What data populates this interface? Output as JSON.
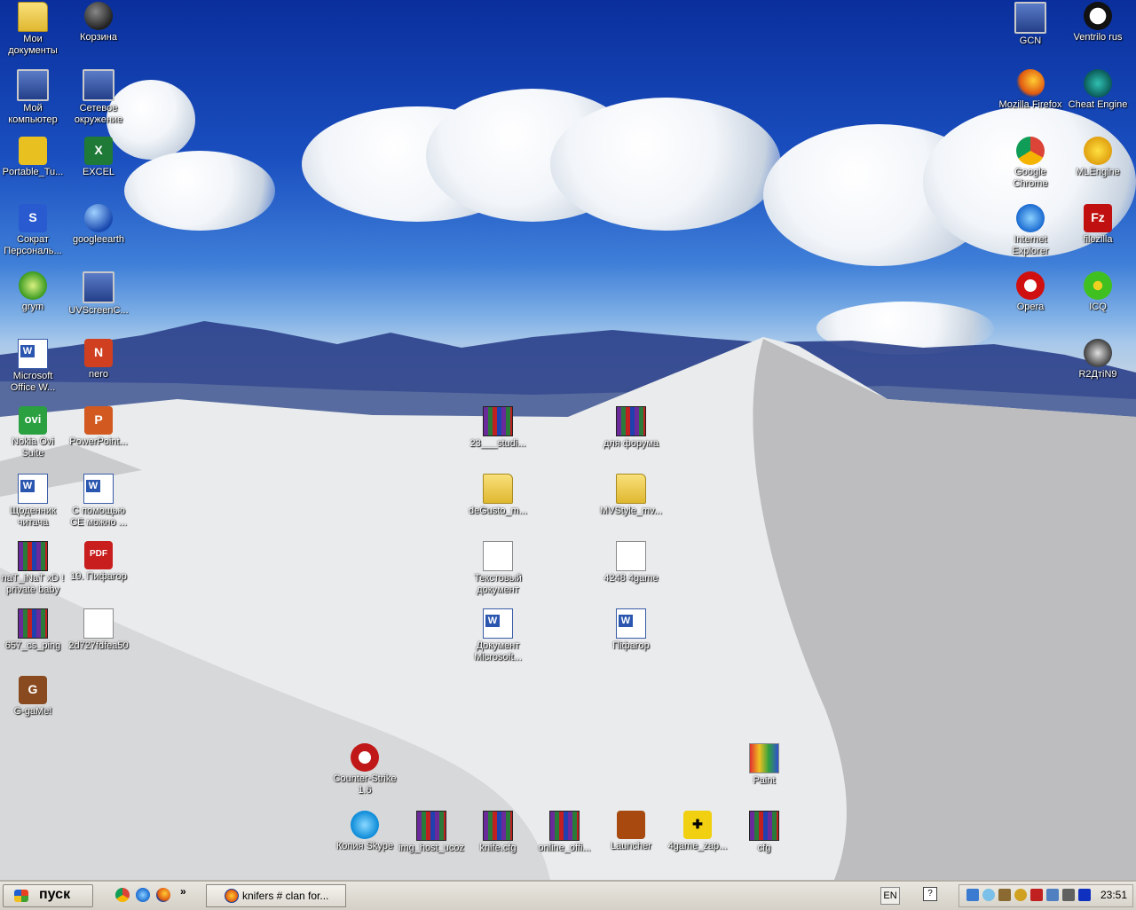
{
  "desktop": {
    "icons_left": [
      {
        "label": "Мои документы"
      },
      {
        "label": "Корзина"
      },
      {
        "label": "Мой компьютер"
      },
      {
        "label": "Сетевое окружение"
      },
      {
        "label": "Portable_Tu..."
      },
      {
        "label": "EXCEL"
      },
      {
        "label": "Сократ Персональ..."
      },
      {
        "label": "googleearth"
      },
      {
        "label": "grym"
      },
      {
        "label": "UVScreenC..."
      },
      {
        "label": "Microsoft Office W..."
      },
      {
        "label": "nero"
      },
      {
        "label": "Nokia Ovi Suite"
      },
      {
        "label": "PowerPoint..."
      },
      {
        "label": "Щоденник читача"
      },
      {
        "label": "С помощью CE можно ..."
      },
      {
        "label": "naT_iNaT xD ! private baby"
      },
      {
        "label": "19. Пифагор"
      },
      {
        "label": "657_cs_ping"
      },
      {
        "label": "2d727fdfea50"
      },
      {
        "label": "G-gaMe!"
      }
    ],
    "icons_right": [
      {
        "label": "GCN"
      },
      {
        "label": "Ventrilo rus"
      },
      {
        "label": "Mozilla Firefox"
      },
      {
        "label": "Cheat Engine"
      },
      {
        "label": "Google Chrome"
      },
      {
        "label": "MLEngine"
      },
      {
        "label": "Internet Explorer"
      },
      {
        "label": "filezilla"
      },
      {
        "label": "Opera"
      },
      {
        "label": "ICQ"
      },
      {
        "label": "R2ДтiN9"
      }
    ],
    "icons_center": [
      {
        "label": "23___studi..."
      },
      {
        "label": "для форума"
      },
      {
        "label": "deGusto_m..."
      },
      {
        "label": "MVStyle_mv..."
      },
      {
        "label": "Текстовый документ"
      },
      {
        "label": "4248 4game"
      },
      {
        "label": "Документ Microsoft..."
      },
      {
        "label": "Піфагор"
      }
    ],
    "icons_bottom": [
      {
        "label": "Counter-Strike 1.6"
      },
      {
        "label": "Paint"
      },
      {
        "label": "Копия Skype"
      },
      {
        "label": "img_host_ucoz"
      },
      {
        "label": "knife.cfg"
      },
      {
        "label": "online_offi..."
      },
      {
        "label": "Launcher"
      },
      {
        "label": "4game_zap..."
      },
      {
        "label": "cfg"
      }
    ]
  },
  "taskbar": {
    "start_label": "пуск",
    "quicklaunch_more": "»",
    "active_task": "knifers # clan for...",
    "lang": "EN",
    "help": "?",
    "clock": "23:51"
  }
}
